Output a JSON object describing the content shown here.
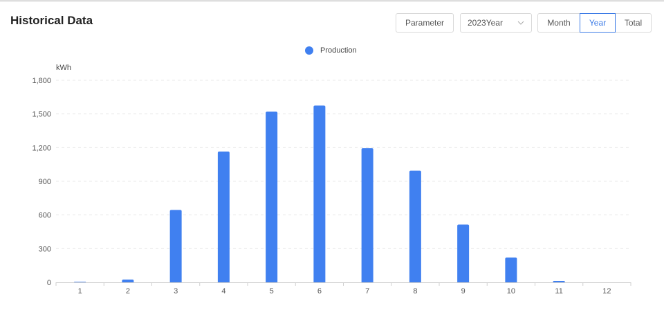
{
  "header": {
    "title": "Historical Data",
    "parameter_label": "Parameter",
    "year_select_value": "2023Year",
    "tabs": [
      {
        "label": "Month",
        "active": false
      },
      {
        "label": "Year",
        "active": true
      },
      {
        "label": "Total",
        "active": false
      }
    ]
  },
  "colors": {
    "accent": "#3c7be6",
    "bar": "#4080f0",
    "grid": "#e8e8e8"
  },
  "chart_data": {
    "type": "bar",
    "unit": "kWh",
    "categories": [
      "1",
      "2",
      "3",
      "4",
      "5",
      "6",
      "7",
      "8",
      "9",
      "10",
      "11",
      "12"
    ],
    "series": [
      {
        "name": "Production",
        "values": [
          5,
          25,
          645,
          1165,
          1520,
          1575,
          1195,
          995,
          515,
          220,
          12,
          0
        ]
      }
    ],
    "yticks": [
      "0",
      "300",
      "600",
      "900",
      "1,200",
      "1,500",
      "1,800"
    ],
    "ylim": [
      0,
      1800
    ],
    "grid": true,
    "legend_position": "top-center"
  }
}
